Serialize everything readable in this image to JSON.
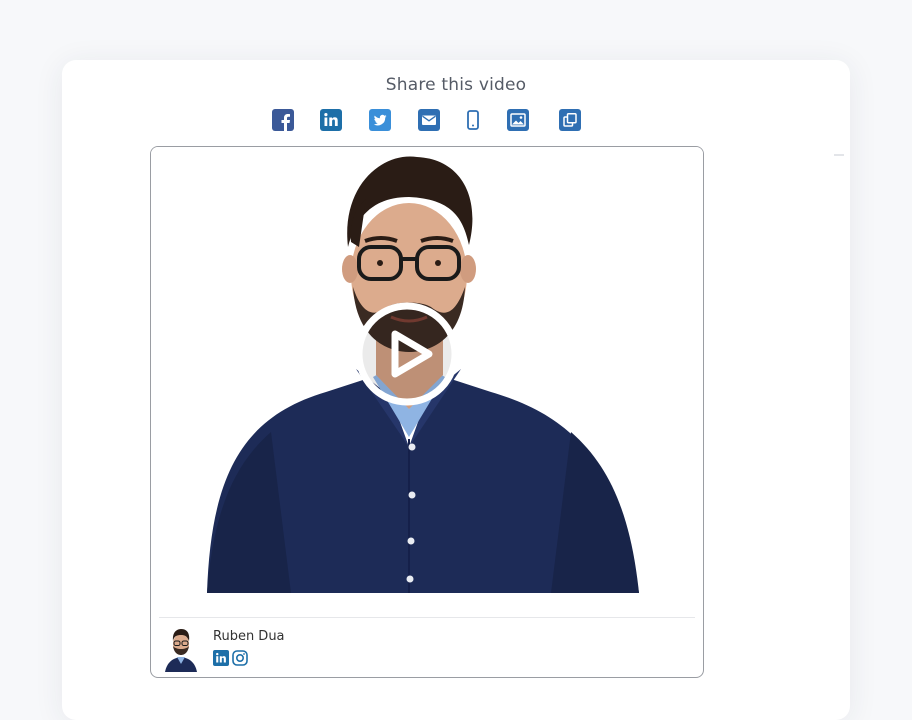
{
  "share": {
    "title": "Share this video",
    "buttons": [
      {
        "name": "facebook",
        "icon": "facebook-icon",
        "color": "#3b5998"
      },
      {
        "name": "linkedin",
        "icon": "linkedin-icon",
        "color": "#1d6fa8"
      },
      {
        "name": "twitter",
        "icon": "twitter-icon",
        "color": "#3a8fd9"
      },
      {
        "name": "email",
        "icon": "email-icon",
        "color": "#2f6fb3"
      },
      {
        "name": "mobile",
        "icon": "mobile-icon",
        "color": "#2f6fb3"
      },
      {
        "name": "image",
        "icon": "image-icon",
        "color": "#2f6fb3"
      },
      {
        "name": "copy",
        "icon": "copy-icon",
        "color": "#2f6fb3"
      }
    ]
  },
  "video": {
    "play_icon": "play-icon"
  },
  "author": {
    "name": "Ruben Dua",
    "links": [
      {
        "name": "linkedin",
        "icon": "linkedin-icon",
        "color": "#1d6fa8"
      },
      {
        "name": "instagram",
        "icon": "instagram-icon",
        "color": "#1d6fa8"
      }
    ]
  }
}
